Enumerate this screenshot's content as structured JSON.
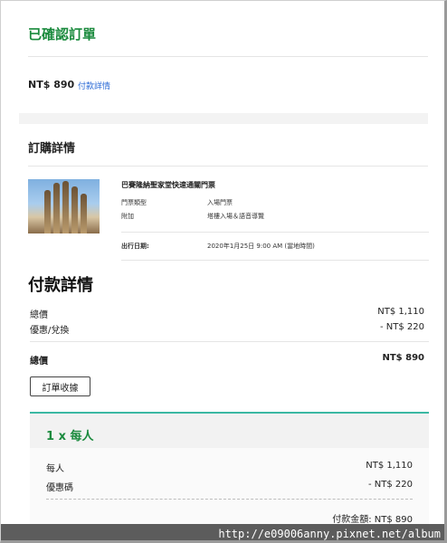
{
  "header": {
    "status": "已確認訂單"
  },
  "summary": {
    "price": "NT$ 890",
    "payment_details_link": "付款詳情"
  },
  "order": {
    "title": "訂購詳情",
    "product_name": "巴賽隆納聖家堂快速通關門票",
    "fields": [
      {
        "label": "門票類型",
        "value": "入場門票"
      },
      {
        "label": "附加",
        "value": "塔樓入場＆語音導覽"
      }
    ],
    "date_label": "出行日期:",
    "date_value": "2020年1月25日 9:00 AM (當地時間)"
  },
  "payment": {
    "title": "付款詳情",
    "subtotal_label": "總價",
    "subtotal_value": "NT$ 1,110",
    "discount_label": "優惠/兌換",
    "discount_value": "- NT$ 220",
    "total_label": "總價",
    "total_value": "NT$ 890",
    "receipt_button": "訂單收據"
  },
  "breakdown": {
    "title": "1 x 每人",
    "person_label": "每人",
    "person_value": "NT$ 1,110",
    "coupon_label": "優惠碼",
    "coupon_value": "- NT$ 220",
    "paid_total": "付款金額: NT$ 890"
  },
  "watermark": "http://e09006anny.pixnet.net/album",
  "colors": {
    "green": "#1a8a3d",
    "link_blue": "#2a6ad6",
    "teal_accent": "#3bb8a3"
  }
}
